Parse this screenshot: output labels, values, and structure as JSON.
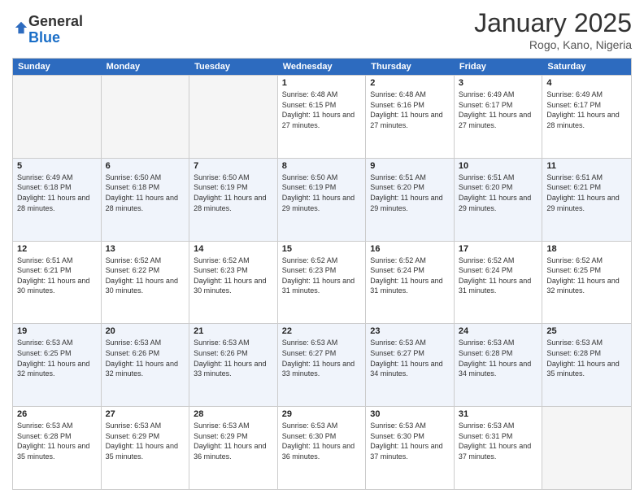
{
  "header": {
    "logo_general": "General",
    "logo_blue": "Blue",
    "month_title": "January 2025",
    "location": "Rogo, Kano, Nigeria"
  },
  "days_of_week": [
    "Sunday",
    "Monday",
    "Tuesday",
    "Wednesday",
    "Thursday",
    "Friday",
    "Saturday"
  ],
  "weeks": [
    [
      {
        "day": "",
        "empty": true
      },
      {
        "day": "",
        "empty": true
      },
      {
        "day": "",
        "empty": true
      },
      {
        "day": "1",
        "sunrise": "6:48 AM",
        "sunset": "6:15 PM",
        "daylight": "11 hours and 27 minutes."
      },
      {
        "day": "2",
        "sunrise": "6:48 AM",
        "sunset": "6:16 PM",
        "daylight": "11 hours and 27 minutes."
      },
      {
        "day": "3",
        "sunrise": "6:49 AM",
        "sunset": "6:17 PM",
        "daylight": "11 hours and 27 minutes."
      },
      {
        "day": "4",
        "sunrise": "6:49 AM",
        "sunset": "6:17 PM",
        "daylight": "11 hours and 28 minutes."
      }
    ],
    [
      {
        "day": "5",
        "sunrise": "6:49 AM",
        "sunset": "6:18 PM",
        "daylight": "11 hours and 28 minutes."
      },
      {
        "day": "6",
        "sunrise": "6:50 AM",
        "sunset": "6:18 PM",
        "daylight": "11 hours and 28 minutes."
      },
      {
        "day": "7",
        "sunrise": "6:50 AM",
        "sunset": "6:19 PM",
        "daylight": "11 hours and 28 minutes."
      },
      {
        "day": "8",
        "sunrise": "6:50 AM",
        "sunset": "6:19 PM",
        "daylight": "11 hours and 29 minutes."
      },
      {
        "day": "9",
        "sunrise": "6:51 AM",
        "sunset": "6:20 PM",
        "daylight": "11 hours and 29 minutes."
      },
      {
        "day": "10",
        "sunrise": "6:51 AM",
        "sunset": "6:20 PM",
        "daylight": "11 hours and 29 minutes."
      },
      {
        "day": "11",
        "sunrise": "6:51 AM",
        "sunset": "6:21 PM",
        "daylight": "11 hours and 29 minutes."
      }
    ],
    [
      {
        "day": "12",
        "sunrise": "6:51 AM",
        "sunset": "6:21 PM",
        "daylight": "11 hours and 30 minutes."
      },
      {
        "day": "13",
        "sunrise": "6:52 AM",
        "sunset": "6:22 PM",
        "daylight": "11 hours and 30 minutes."
      },
      {
        "day": "14",
        "sunrise": "6:52 AM",
        "sunset": "6:23 PM",
        "daylight": "11 hours and 30 minutes."
      },
      {
        "day": "15",
        "sunrise": "6:52 AM",
        "sunset": "6:23 PM",
        "daylight": "11 hours and 31 minutes."
      },
      {
        "day": "16",
        "sunrise": "6:52 AM",
        "sunset": "6:24 PM",
        "daylight": "11 hours and 31 minutes."
      },
      {
        "day": "17",
        "sunrise": "6:52 AM",
        "sunset": "6:24 PM",
        "daylight": "11 hours and 31 minutes."
      },
      {
        "day": "18",
        "sunrise": "6:52 AM",
        "sunset": "6:25 PM",
        "daylight": "11 hours and 32 minutes."
      }
    ],
    [
      {
        "day": "19",
        "sunrise": "6:53 AM",
        "sunset": "6:25 PM",
        "daylight": "11 hours and 32 minutes."
      },
      {
        "day": "20",
        "sunrise": "6:53 AM",
        "sunset": "6:26 PM",
        "daylight": "11 hours and 32 minutes."
      },
      {
        "day": "21",
        "sunrise": "6:53 AM",
        "sunset": "6:26 PM",
        "daylight": "11 hours and 33 minutes."
      },
      {
        "day": "22",
        "sunrise": "6:53 AM",
        "sunset": "6:27 PM",
        "daylight": "11 hours and 33 minutes."
      },
      {
        "day": "23",
        "sunrise": "6:53 AM",
        "sunset": "6:27 PM",
        "daylight": "11 hours and 34 minutes."
      },
      {
        "day": "24",
        "sunrise": "6:53 AM",
        "sunset": "6:28 PM",
        "daylight": "11 hours and 34 minutes."
      },
      {
        "day": "25",
        "sunrise": "6:53 AM",
        "sunset": "6:28 PM",
        "daylight": "11 hours and 35 minutes."
      }
    ],
    [
      {
        "day": "26",
        "sunrise": "6:53 AM",
        "sunset": "6:28 PM",
        "daylight": "11 hours and 35 minutes."
      },
      {
        "day": "27",
        "sunrise": "6:53 AM",
        "sunset": "6:29 PM",
        "daylight": "11 hours and 35 minutes."
      },
      {
        "day": "28",
        "sunrise": "6:53 AM",
        "sunset": "6:29 PM",
        "daylight": "11 hours and 36 minutes."
      },
      {
        "day": "29",
        "sunrise": "6:53 AM",
        "sunset": "6:30 PM",
        "daylight": "11 hours and 36 minutes."
      },
      {
        "day": "30",
        "sunrise": "6:53 AM",
        "sunset": "6:30 PM",
        "daylight": "11 hours and 37 minutes."
      },
      {
        "day": "31",
        "sunrise": "6:53 AM",
        "sunset": "6:31 PM",
        "daylight": "11 hours and 37 minutes."
      },
      {
        "day": "",
        "empty": true
      }
    ]
  ],
  "labels": {
    "sunrise": "Sunrise:",
    "sunset": "Sunset:",
    "daylight": "Daylight:"
  }
}
